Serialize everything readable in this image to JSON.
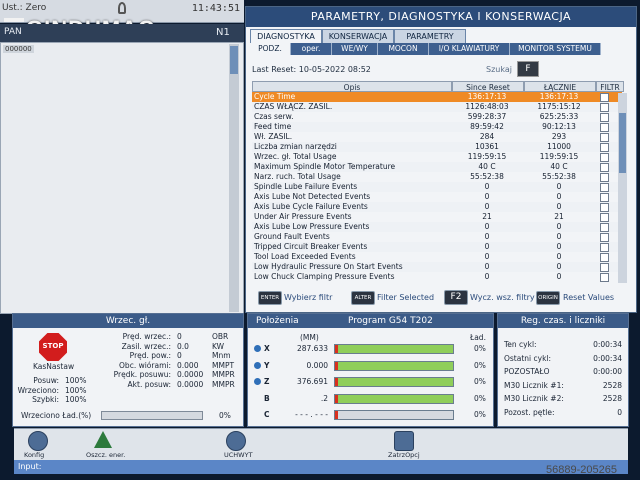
{
  "topbar": {
    "status": "Ust.: Zero",
    "clock": "11:43:51",
    "mode": "PAN",
    "channel": "N1",
    "mini_label": "000000"
  },
  "brand": "GINDUMAC",
  "panel": {
    "title": "PARAMETRY, DIAGNOSTYKA I KONSERWACJA",
    "tabs": [
      "DIAGNOSTYKA",
      "KONSERWACJA",
      "PARAMETRY"
    ],
    "subtabs": [
      "PODZ.",
      "oper.",
      "WE/WY",
      "MOCON",
      "I/O KLAWIATURY",
      "MONITOR SYSTEMU"
    ],
    "last_reset_label": "Last Reset:",
    "last_reset_value": "10-05-2022 08:52",
    "search_label": "Szukaj",
    "search_key": "F",
    "columns": [
      "Opis",
      "Since Reset",
      "ŁĄCZNIE",
      "FILTR"
    ],
    "rows": [
      {
        "name": "Cycle Time",
        "since": "136:17:13",
        "total": "136:17:13"
      },
      {
        "name": "CZAS WŁĄCZ. ZASIL.",
        "since": "1126:48:03",
        "total": "1175:15:12"
      },
      {
        "name": "Czas serw.",
        "since": "599:28:37",
        "total": "625:25:33"
      },
      {
        "name": "Feed time",
        "since": "89:59:42",
        "total": "90:12:13"
      },
      {
        "name": "Wł. ZASIL.",
        "since": "284",
        "total": "293"
      },
      {
        "name": "Liczba zmian narzędzi",
        "since": "10361",
        "total": "11000"
      },
      {
        "name": "Wrzec. gł. Total Usage",
        "since": "119:59:15",
        "total": "119:59:15"
      },
      {
        "name": "Maximum Spindle Motor Temperature",
        "since": "40 C",
        "total": "40 C"
      },
      {
        "name": "Narz. ruch. Total Usage",
        "since": "55:52:38",
        "total": "55:52:38"
      },
      {
        "name": "Spindle Lube Failure Events",
        "since": "0",
        "total": "0"
      },
      {
        "name": "Axis Lube Not Detected Events",
        "since": "0",
        "total": "0"
      },
      {
        "name": "Axis Lube Cycle Failure Events",
        "since": "0",
        "total": "0"
      },
      {
        "name": "Under Air Pressure Events",
        "since": "21",
        "total": "21"
      },
      {
        "name": "Axis Lube Low Pressure Events",
        "since": "0",
        "total": "0"
      },
      {
        "name": "Ground Fault Events",
        "since": "0",
        "total": "0"
      },
      {
        "name": "Tripped Circuit Breaker Events",
        "since": "0",
        "total": "0"
      },
      {
        "name": "Tool Load Exceeded Events",
        "since": "0",
        "total": "0"
      },
      {
        "name": "Low Hydraulic Pressure On Start Events",
        "since": "0",
        "total": "0"
      },
      {
        "name": "Low Chuck Clamping Pressure Events",
        "since": "0",
        "total": "0"
      }
    ],
    "actions": [
      {
        "key": "ENTER",
        "label": "Wybierz filtr"
      },
      {
        "key": "ALTER",
        "label": "Filter Selected"
      },
      {
        "key": "F2",
        "label": "Wycz. wsz. filtry"
      },
      {
        "key": "ORIGIN",
        "label": "Reset Values"
      }
    ]
  },
  "spindle": {
    "title": "Wrzec. gł.",
    "stop_label": "STOP",
    "stop_caption": "KasNastaw",
    "rows": [
      {
        "label": "Pręd. wrzec.:",
        "value": "0",
        "unit": "OBR"
      },
      {
        "label": "Zasil. wrzec.:",
        "value": "0.0",
        "unit": "KW"
      },
      {
        "label": "Pręd. pow.:",
        "value": "0",
        "unit": "Mnm"
      },
      {
        "label": "Obc. wiórami:",
        "value": "0.000",
        "unit": "MMPT"
      },
      {
        "label": "Prędk. posuwu:",
        "value": "0.0000",
        "unit": "MMPR"
      },
      {
        "label": "Akt. posuw:",
        "value": "0.0000",
        "unit": "MMPR"
      }
    ],
    "overrides": [
      {
        "label": "Posuw:",
        "value": "100%"
      },
      {
        "label": "Wrzeciono:",
        "value": "100%"
      },
      {
        "label": "Szybki:",
        "value": "100%"
      }
    ],
    "load_label": "Wrzeciono Ład.(%)",
    "load_value": "0%",
    "load_fraction": 0.0
  },
  "position": {
    "title": "Położenia",
    "program": "Program G54 T202",
    "col_mm": "(MM)",
    "col_load": "Ład.",
    "axes": [
      {
        "axis": "X",
        "value": "287.633",
        "load": "0%"
      },
      {
        "axis": "Y",
        "value": "0.000",
        "load": "0%"
      },
      {
        "axis": "Z",
        "value": "376.691",
        "load": "0%"
      },
      {
        "axis": "B",
        "value": ".2",
        "load": "0%"
      },
      {
        "axis": "C",
        "value": "- - - . - - -",
        "load": "0%"
      }
    ]
  },
  "timers": {
    "title": "Reg. czas. i liczniki",
    "rows": [
      {
        "label": "Ten cykl:",
        "value": "0:00:34"
      },
      {
        "label": "Ostatni cykl:",
        "value": "0:00:34"
      },
      {
        "label": "POZOSTAŁO",
        "value": "0:00:00"
      },
      {
        "label": "M30 Licznik #1:",
        "value": "2528"
      },
      {
        "label": "M30 Licznik #2:",
        "value": "2528"
      },
      {
        "label": "Pozost. pętle:",
        "value": "0"
      }
    ]
  },
  "footer": {
    "items": [
      "Konfig",
      "Oszcz. ener.",
      "UCHWYT",
      "ZatrzOpcj"
    ],
    "input_label": "Input:"
  },
  "watermark": "56889-205265"
}
